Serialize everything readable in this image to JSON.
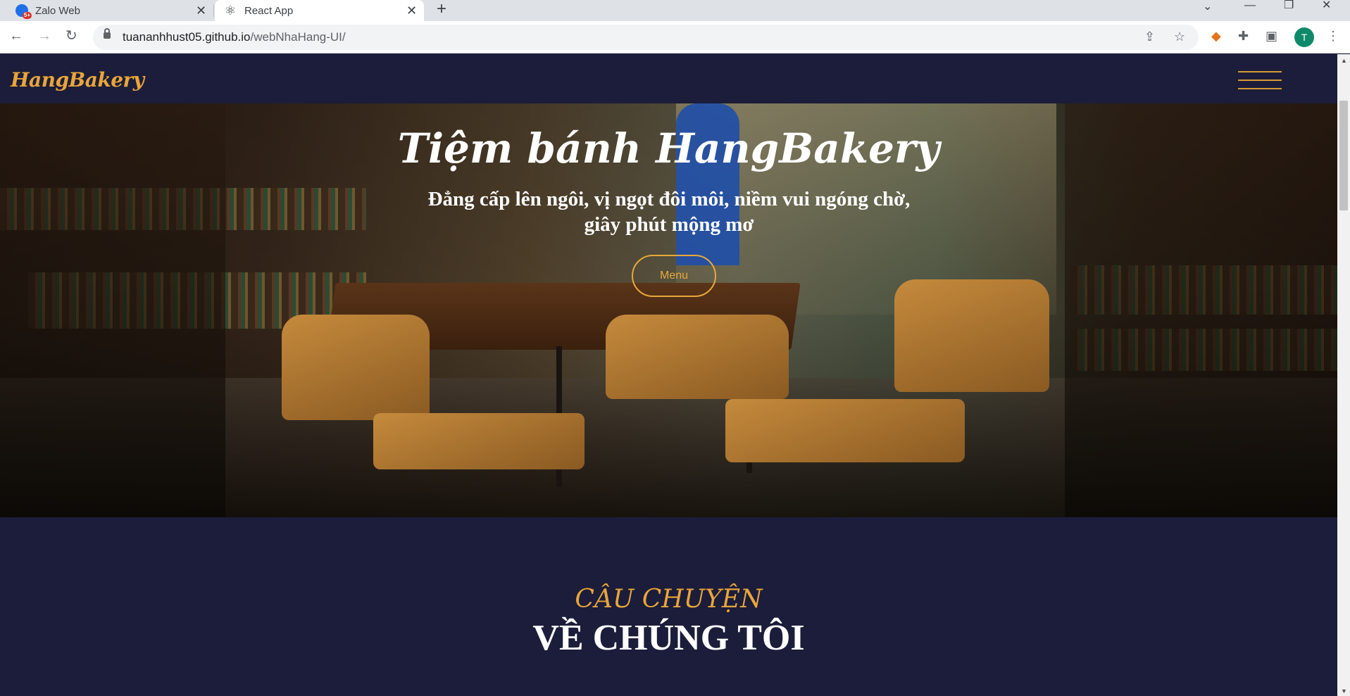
{
  "browser": {
    "tabs": [
      {
        "title": "Zalo Web",
        "badge": "5+"
      },
      {
        "title": "React App"
      }
    ],
    "new_tab_symbol": "+",
    "address": {
      "host": "tuananhhust05.github.io",
      "path": "/webNhaHang-UI/"
    },
    "profile_initial": "T"
  },
  "site": {
    "logo": "HangBakery",
    "hero": {
      "title": "Tiệm bánh HangBakery",
      "subtitle": "Đẳng cấp lên ngôi, vị ngọt đôi môi, niềm vui ngóng chờ, giây phút mộng mơ",
      "button": "Menu"
    },
    "story": {
      "kicker": "CÂU CHUYỆN",
      "title": "VỀ CHÚNG TÔI"
    }
  },
  "colors": {
    "navy": "#1b1d3a",
    "accent": "#e9a53a"
  }
}
